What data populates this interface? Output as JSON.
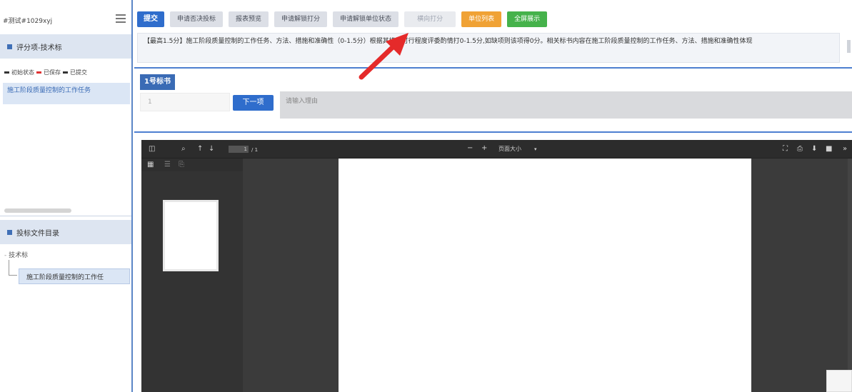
{
  "sidebar": {
    "title": "#测试#1029xyj",
    "section_score": "评分项-技术标",
    "legend": {
      "initial": "初始状态",
      "saved": "已保存",
      "submitted": "已提交"
    },
    "selected_item": "施工阶段质量控制的工作任务",
    "section_docs": "投标文件目录",
    "tree_root": "技术标",
    "tree_child": "施工阶段质量控制的工作任"
  },
  "toolbar": {
    "submit": "提交",
    "apply_deny": "申请否决投标",
    "report_preview": "报表预览",
    "apply_unlock_score": "申请解锁打分",
    "apply_unlock_unit": "申请解锁单位状态",
    "horizontal_score": "横向打分",
    "unit_list": "单位列表",
    "fullscreen": "全屏展示"
  },
  "description": "【最高1.5分】施工阶段质量控制的工作任务、方法、措施和准确性（0-1.5分）根据其措施可行程度评委酌情打0-1.5分,如缺项则该项得0分。相关标书内容在施工阶段质量控制的工作任务、方法、措施和准确性体现",
  "bid": {
    "label": "1号标书",
    "page_value": "1",
    "next_label": "下一项",
    "reason_placeholder": "请输入理由"
  },
  "viewer": {
    "page_total": "/ 1",
    "zoom_label": "页面大小"
  },
  "colors": {
    "primary": "#2f6dcc",
    "orange": "#f0a235",
    "green": "#45b24b",
    "arrow": "#e52a2a"
  }
}
